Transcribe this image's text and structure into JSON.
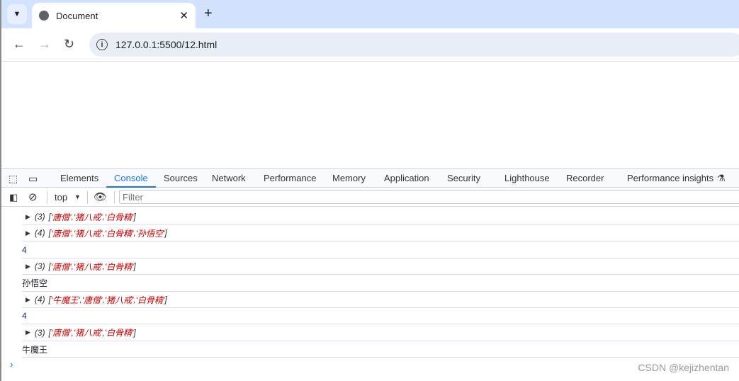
{
  "browser": {
    "tab_title": "Document",
    "url": "127.0.0.1:5500/12.html"
  },
  "devtools": {
    "tabs": [
      "Elements",
      "Console",
      "Sources",
      "Network",
      "Performance",
      "Memory",
      "Application",
      "Security",
      "Lighthouse",
      "Recorder",
      "Performance insights"
    ],
    "active_tab": "Console",
    "context": "top",
    "filter_placeholder": "Filter"
  },
  "console": [
    {
      "type": "array",
      "count": "(3)",
      "items": [
        "唐僧",
        "猪八戒",
        "白骨精"
      ]
    },
    {
      "type": "array",
      "count": "(4)",
      "items": [
        "唐僧",
        "猪八戒",
        "白骨精",
        "孙悟空"
      ]
    },
    {
      "type": "number",
      "value": "4"
    },
    {
      "type": "array",
      "count": "(3)",
      "items": [
        "唐僧",
        "猪八戒",
        "白骨精"
      ]
    },
    {
      "type": "string",
      "value": "孙悟空"
    },
    {
      "type": "array",
      "count": "(4)",
      "items": [
        "牛魔王",
        "唐僧",
        "猪八戒",
        "白骨精"
      ]
    },
    {
      "type": "number",
      "value": "4"
    },
    {
      "type": "array",
      "count": "(3)",
      "items": [
        "唐僧",
        "猪八戒",
        "白骨精"
      ]
    },
    {
      "type": "string",
      "value": "牛魔王"
    }
  ],
  "watermark": "CSDN @kejizhentan"
}
